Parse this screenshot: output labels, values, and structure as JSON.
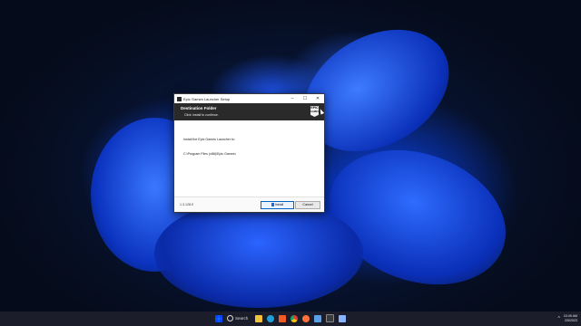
{
  "window": {
    "title": "Epic Games Launcher Setup",
    "controls": {
      "minimize": "–",
      "maximize": "☐",
      "close": "✕"
    }
  },
  "header": {
    "title": "Destination Folder",
    "subtitle": "Click Install to continue.",
    "logo_line1": "EPIC",
    "logo_line2": "GAMES"
  },
  "content": {
    "description": "Install the Epic Games Launcher to:",
    "path": "C:\\Program Files (x86)\\Epic Games\\"
  },
  "footer": {
    "version": "1.3.128.0",
    "install_label": "Install",
    "cancel_label": "Cancel"
  },
  "taskbar": {
    "search_label": "Search",
    "time": "10:49 AM",
    "date": "2/5/2023"
  },
  "colors": {
    "accent": "#0a55ff",
    "dialog_header": "#2a2a2a",
    "taskbar": "#1b1d2b"
  }
}
